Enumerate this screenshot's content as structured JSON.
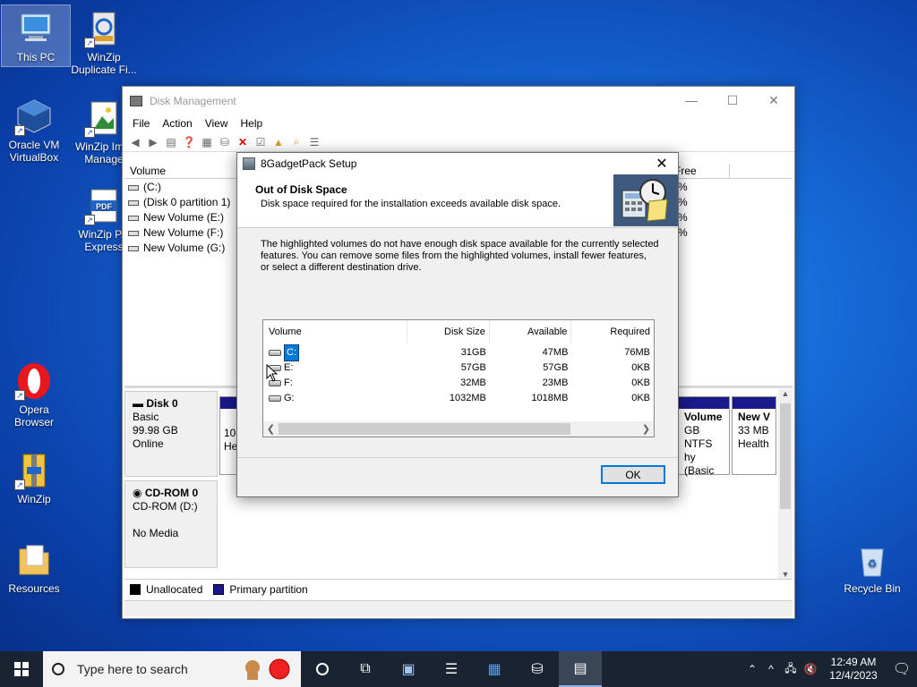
{
  "desktop": {
    "icons": [
      {
        "label": "This PC"
      },
      {
        "label": "WinZip Duplicate Fi..."
      },
      {
        "label": "Oracle VM VirtualBox"
      },
      {
        "label": "WinZip Im... Manage"
      },
      {
        "label": "WinZip P... Express"
      },
      {
        "label": "Opera Browser"
      },
      {
        "label": "WinZip"
      },
      {
        "label": "Resources"
      },
      {
        "label": "Recycle Bin"
      }
    ]
  },
  "disk_management": {
    "title": "Disk Management",
    "menu": [
      "File",
      "Action",
      "View",
      "Help"
    ],
    "column_volume": "Volume",
    "column_free": "Free",
    "volumes": [
      "(C:)",
      "(Disk 0 partition 1)",
      "New Volume (E:)",
      "New Volume (F:)",
      "New Volume (G:)"
    ],
    "percent_values": [
      "%",
      "%",
      "%",
      "%"
    ],
    "disk0": {
      "name": "Disk 0",
      "type": "Basic",
      "size": "99.98 GB",
      "status": "Online"
    },
    "cdrom0": {
      "name": "CD-ROM 0",
      "type": "CD-ROM (D:)",
      "status": "No Media"
    },
    "partition_left": {
      "line1": "10(",
      "line2": "He"
    },
    "partition_mid": {
      "title": "Volume",
      "line1": "GB NTFS",
      "line2": "hy (Basic"
    },
    "partition_right": {
      "title": "New V",
      "line1": "33 MB",
      "line2": "Health"
    },
    "legend": {
      "unallocated": "Unallocated",
      "primary": "Primary partition"
    }
  },
  "setup_dialog": {
    "title": "8GadgetPack Setup",
    "heading": "Out of Disk Space",
    "subheading": "Disk space required for the installation exceeds available disk space.",
    "body_line1": "The highlighted volumes do not have enough disk space available for the currently selected",
    "body_line2": "features. You can remove some files from the highlighted volumes, install fewer features,",
    "body_line3": "or select a different destination drive.",
    "columns": {
      "volume": "Volume",
      "disk_size": "Disk Size",
      "available": "Available",
      "required": "Required"
    },
    "rows": [
      {
        "volume": "C:",
        "disk_size": "31GB",
        "available": "47MB",
        "required": "76MB"
      },
      {
        "volume": "E:",
        "disk_size": "57GB",
        "available": "57GB",
        "required": "0KB"
      },
      {
        "volume": "F:",
        "disk_size": "32MB",
        "available": "23MB",
        "required": "0KB"
      },
      {
        "volume": "G:",
        "disk_size": "1032MB",
        "available": "1018MB",
        "required": "0KB"
      }
    ],
    "ok_label": "OK"
  },
  "taskbar": {
    "search_placeholder": "Type here to search",
    "time": "12:49 AM",
    "date": "12/4/2023"
  }
}
